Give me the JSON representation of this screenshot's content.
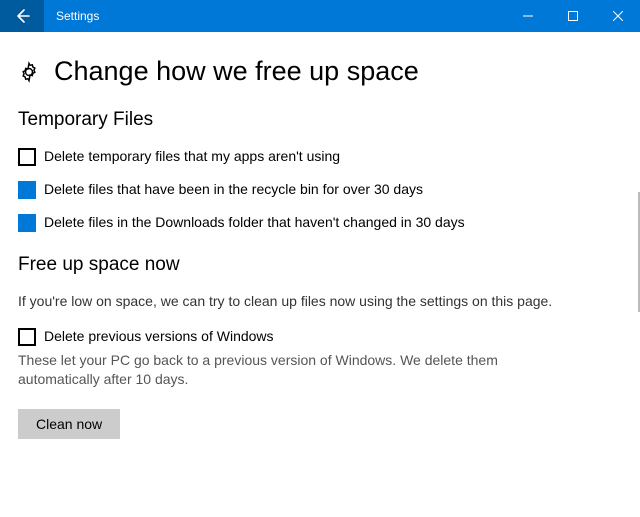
{
  "window": {
    "title": "Settings"
  },
  "page": {
    "heading": "Change how we free up space"
  },
  "temp": {
    "heading": "Temporary Files",
    "opt1": {
      "label": "Delete temporary files that my apps aren't using",
      "checked": false
    },
    "opt2": {
      "label": "Delete files that have been in the recycle bin for over 30 days",
      "checked": true
    },
    "opt3": {
      "label": "Delete files in the Downloads folder that haven't changed in 30 days",
      "checked": true
    }
  },
  "freeup": {
    "heading": "Free up space now",
    "body": "If you're low on space, we can try to clean up files now using the settings on this page.",
    "opt": {
      "label": "Delete previous versions of Windows",
      "checked": false
    },
    "help": "These let your PC go back to a previous version of Windows. We delete them automatically after 10 days.",
    "button": "Clean now"
  }
}
